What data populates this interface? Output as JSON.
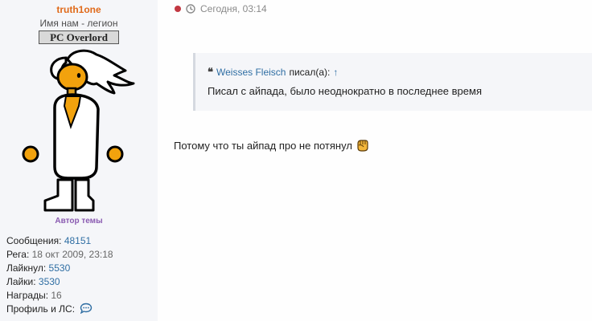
{
  "author": {
    "username": "truth1one",
    "user_title": "Имя нам - легион",
    "rank_badge": "PC Overlord",
    "topic_author_label": "Автор темы",
    "stats": [
      {
        "label": "Сообщения:",
        "value": "48151",
        "style": "link"
      },
      {
        "label": "Рега:",
        "value": "18 окт 2009, 23:18",
        "style": "plain"
      },
      {
        "label": "Лайкнул:",
        "value": "5530",
        "style": "link"
      },
      {
        "label": "Лайки:",
        "value": "3530",
        "style": "link"
      },
      {
        "label": "Награды:",
        "value": "16",
        "style": "plain"
      },
      {
        "label": "Профиль и ЛС:",
        "value": "",
        "style": "icon"
      }
    ]
  },
  "post": {
    "timestamp": "Сегодня, 03:14",
    "quote": {
      "author": "Weisses Fleisch",
      "wrote_label": "писал(а):",
      "arrow": "↑",
      "text": "Писал с айпада, было неоднократно в последнее время"
    },
    "text": "Потому что ты айпад про не потянул"
  },
  "colors": {
    "username": "#e06a1a",
    "link": "#2f6ea3",
    "topic_author": "#8a5bb1",
    "online_dot": "#c23842",
    "sidebar_bg": "#f5f6f9"
  },
  "icons": {
    "timestamp": "clock-icon",
    "quote": "quote-icon",
    "profile": "chat-bubble-icon",
    "emoji": "fist-emoji-icon"
  }
}
